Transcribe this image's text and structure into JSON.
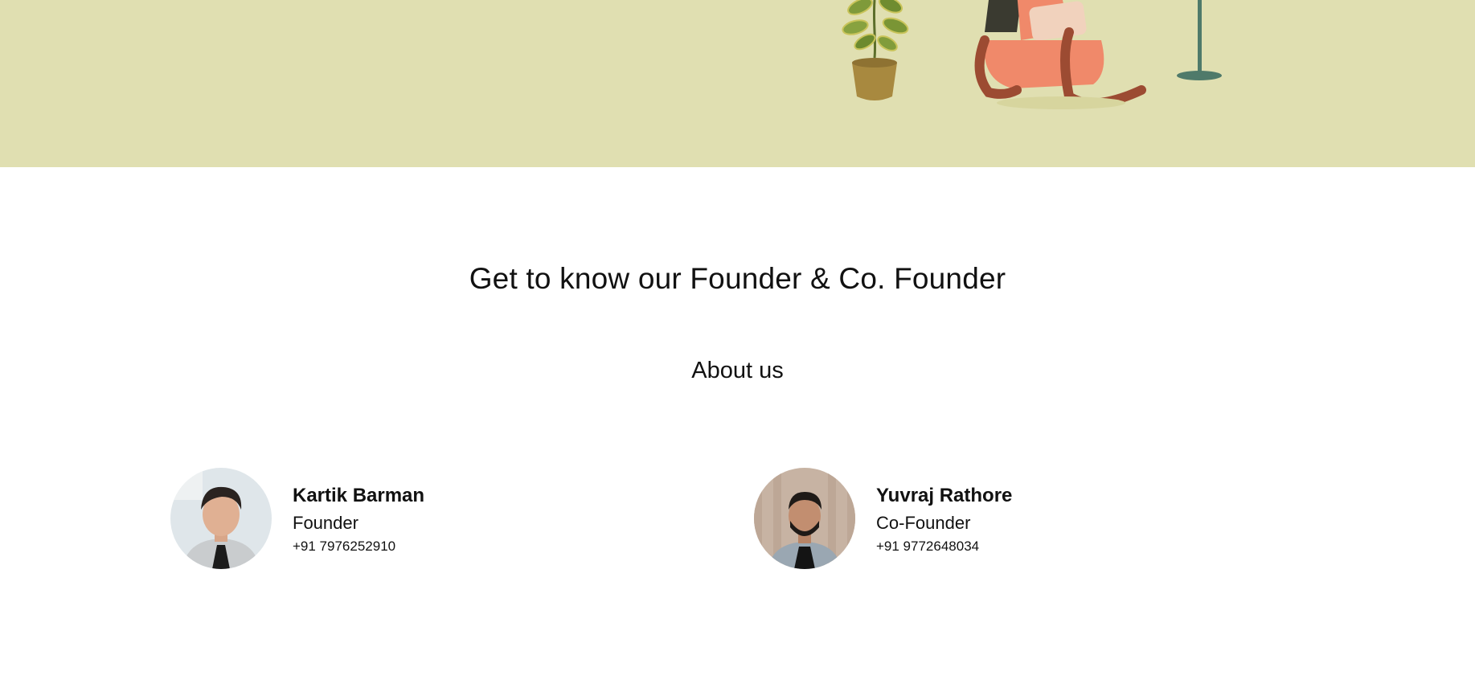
{
  "hero": {
    "background": "#e0dfb1",
    "illustration": [
      "potted-plant-icon",
      "armchair-icon",
      "floor-lamp-icon"
    ]
  },
  "about": {
    "title": "Get to know our Founder & Co. Founder",
    "subtitle": "About us"
  },
  "team": [
    {
      "name": "Kartik Barman",
      "role": "Founder",
      "phone": "+91 7976252910",
      "avatar": "avatar-photo"
    },
    {
      "name": "Yuvraj Rathore",
      "role": "Co-Founder",
      "phone": "+91 9772648034",
      "avatar": "avatar-photo"
    }
  ]
}
